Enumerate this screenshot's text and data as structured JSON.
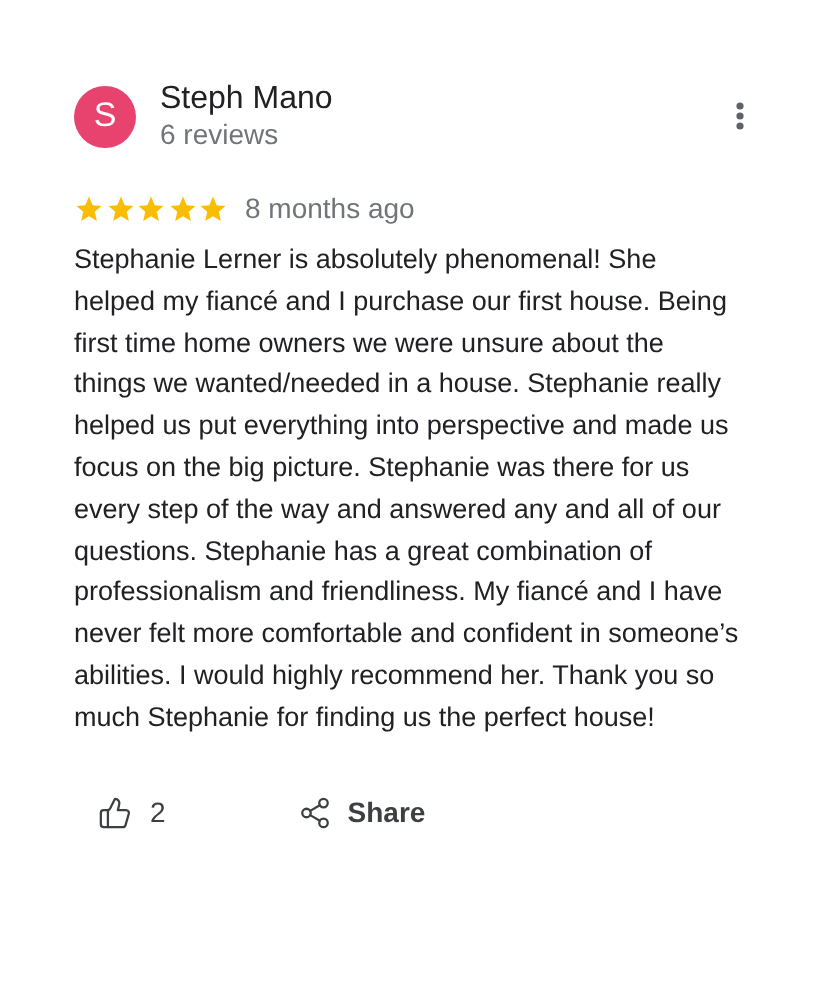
{
  "review": {
    "avatar_letter": "S",
    "author": "Steph Mano",
    "review_count": "6 reviews",
    "stars": 5,
    "time": "8 months ago",
    "text": "Stephanie Lerner is absolutely phenomenal! She helped my fiancé and I purchase our first house. Being first time home owners we were unsure about the things we wanted/needed in a house. Stephanie really helped us put everything into perspective and made us focus on the big picture. Stephanie was there for us every step of the way and answered any and all of our questions. Stephanie has a great combination of professionalism and friendliness. My fiancé and I have never felt more comfortable and confident in someone’s abilities. I would highly recommend her. Thank you so much Stephanie for finding us the perfect house!",
    "likes": "2",
    "share_label": "Share"
  }
}
